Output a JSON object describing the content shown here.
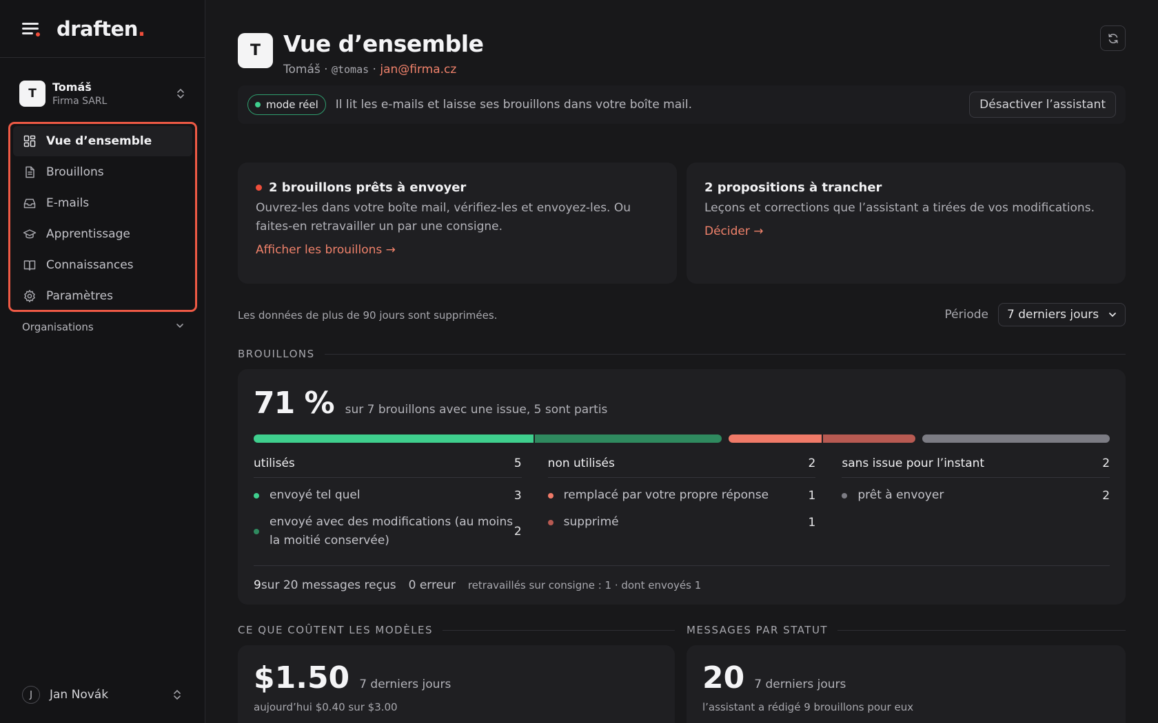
{
  "brand": {
    "name": "draften",
    "dot": "."
  },
  "account": {
    "initial": "T",
    "name": "Tomáš",
    "org": "Firma SARL"
  },
  "nav": [
    {
      "label": "Vue d’ensemble",
      "icon": "grid-icon",
      "active": true
    },
    {
      "label": "Brouillons",
      "icon": "document-icon"
    },
    {
      "label": "E-mails",
      "icon": "inbox-icon"
    },
    {
      "label": "Apprentissage",
      "icon": "graduation-cap-icon"
    },
    {
      "label": "Connaissances",
      "icon": "book-icon"
    },
    {
      "label": "Paramètres",
      "icon": "gear-icon"
    }
  ],
  "orgs_label": "Organisations",
  "user": {
    "initial": "J",
    "name": "Jan Novák"
  },
  "header": {
    "initial": "T",
    "title": "Vue d’ensemble",
    "name": "Tomáš",
    "sep": " · ",
    "handle": "@tomas",
    "email": "jan@firma.cz"
  },
  "banner": {
    "pill": "mode réel",
    "text": "Il lit les e-mails et laisse ses brouillons dans votre boîte mail.",
    "button": "Désactiver l’assistant"
  },
  "cards": [
    {
      "title": "2 brouillons prêts à envoyer",
      "body": "Ouvrez-les dans votre boîte mail, vérifiez-les et envoyez-les. Ou faites-en retravailler un par une consigne.",
      "link": "Afficher les brouillons →"
    },
    {
      "title": "2 propositions à trancher",
      "body": "Leçons et corrections que l’assistant a tirées de vos modifications.",
      "link": "Décider →"
    }
  ],
  "note": "Les données de plus de 90 jours sont supprimées.",
  "period": {
    "label": "Période",
    "value": "7 derniers jours"
  },
  "drafts": {
    "section": "BROUILLONS",
    "kpi": "71 %",
    "kpi_sub": "sur 7 brouillons avec une issue, 5 sont partis",
    "bar": {
      "sent_as_is": 3,
      "sent_modified": 2,
      "replaced": 1,
      "deleted": 1,
      "pending": 2
    },
    "columns": [
      {
        "title": "utilisés",
        "count": "5",
        "rows": [
          {
            "label": "envoyé tel quel",
            "value": "3",
            "color": "#3fcf8e"
          },
          {
            "label": "envoyé avec des modifications (au moins la moitié conservée)",
            "value": "2",
            "color": "#2f8a5f"
          }
        ]
      },
      {
        "title": "non utilisés",
        "count": "2",
        "rows": [
          {
            "label": "remplacé par votre propre réponse",
            "value": "1",
            "color": "#f07a68"
          },
          {
            "label": "supprimé",
            "value": "1",
            "color": "#b85a52"
          }
        ]
      },
      {
        "title": "sans issue pour l’instant",
        "count": "2",
        "rows": [
          {
            "label": "prêt à envoyer",
            "value": "2",
            "color": "#7c7c84"
          }
        ]
      }
    ],
    "foot": {
      "count": "9",
      "received": " sur 20 messages reçus",
      "errors": "0 erreur",
      "rework": "retravaillés sur consigne : 1 · dont envoyés 1"
    }
  },
  "costs": {
    "section": "CE QUE COÛTENT LES MODÈLES",
    "value": "$1.50",
    "sub": "7 derniers jours",
    "note": "aujourd’hui $0.40 sur $3.00"
  },
  "messages": {
    "section": "MESSAGES PAR STATUT",
    "value": "20",
    "sub": "7 derniers jours",
    "note": "l’assistant a rédigé 9 brouillons pour eux"
  },
  "colors": {
    "accent": "#ef4e3b",
    "link": "#f0826b",
    "green": "#3fcf8e",
    "green_dark": "#2f8a5f",
    "red": "#f07a68",
    "red_dark": "#b85a52",
    "gray": "#7c7c84"
  }
}
